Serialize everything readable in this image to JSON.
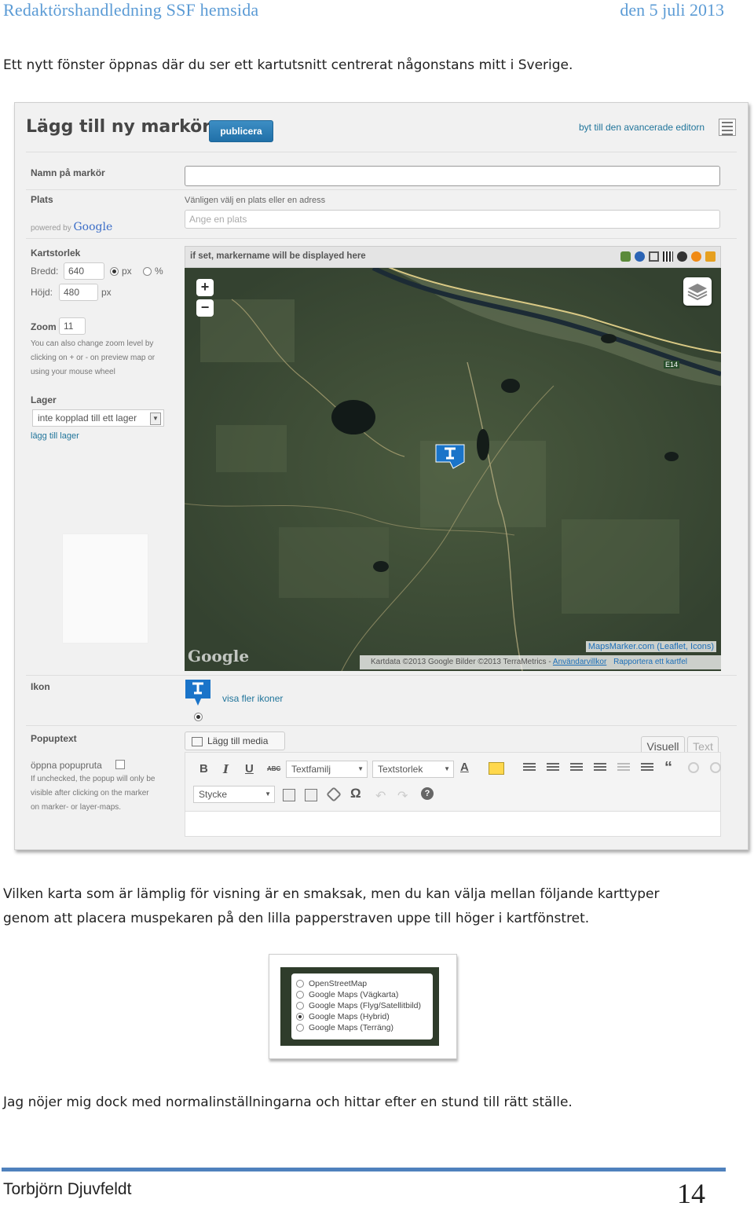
{
  "header": {
    "doc_title": "Redaktörshandledning SSF hemsida",
    "date": "den 5 juli 2013"
  },
  "intro": "Ett nytt fönster öppnas där du ser ett kartutsnitt centrerat någonstans mitt i Sverige.",
  "editor_screen": {
    "title": "Lägg till ny markör",
    "publish_label": "publicera",
    "switch_editor_label": "byt till den avancerade editorn",
    "name_label": "Namn på markör",
    "name_value": "",
    "place_label": "Plats",
    "powered_by": "powered by",
    "google_label": "Google",
    "place_hint": "Vänligen välj en plats eller en adress",
    "place_placeholder": "Ange en plats",
    "mapsize_label": "Kartstorlek",
    "width_label": "Bredd:",
    "width_value": "640",
    "unit_px": "px",
    "unit_pct": "%",
    "height_label": "Höjd:",
    "height_value": "480",
    "height_unit": "px",
    "zoom_label": "Zoom",
    "zoom_value": "11",
    "zoom_note_1": "You can also change zoom level by",
    "zoom_note_2": "clicking on + or - on preview map or",
    "zoom_note_3": "using your mouse wheel",
    "layer_label": "Lager",
    "layer_value": "inte kopplad till ett lager",
    "add_layer_link": "lägg till lager",
    "map_caption": "if set, markername will be displayed here",
    "zoom_in": "+",
    "zoom_out": "−",
    "road_label": "E14",
    "attribution_link": "MapsMarker.com (Leaflet, Icons)",
    "map_credits": "Kartdata ©2013 Google Bilder ©2013 TerraMetrics -",
    "terms_link": "Användarvillkor",
    "report_link": "Rapportera ett kartfel",
    "google_watermark": "Google",
    "icon_label": "Ikon",
    "more_icons_link": "visa fler ikoner",
    "popup_label": "Popuptext",
    "add_media_label": "Lägg till media",
    "tab_visual": "Visuell",
    "tab_text": "Text",
    "open_popup_label": "öppna popupruta",
    "popup_note_1": "If unchecked, the popup will only be",
    "popup_note_2": "visible after clicking on the marker",
    "popup_note_3": "on marker- or layer-maps.",
    "font_family_select": "Textfamilj",
    "font_size_select": "Textstorlek",
    "format_select": "Stycke",
    "tb_bold": "B",
    "tb_italic": "I",
    "tb_underline": "U",
    "tb_strike": "ABC",
    "tb_quote": "“",
    "tb_omega": "Ω",
    "tb_help": "?"
  },
  "middle_text_line1": "Vilken karta som är lämplig för visning är en smaksak, men du kan välja mellan följande karttyper",
  "middle_text_line2": "genom att placera muspekaren på den lilla papperstraven uppe till höger i kartfönstret.",
  "map_types": {
    "options": [
      "OpenStreetMap",
      "Google Maps (Vägkarta)",
      "Google Maps (Flyg/Satellitbild)",
      "Google Maps (Hybrid)",
      "Google Maps (Terräng)"
    ],
    "selected": "Google Maps (Hybrid)"
  },
  "closing_text": "Jag nöjer mig dock med normalinställningarna och hittar efter en stund till rätt ställe.",
  "footer": {
    "author": "Torbjörn Djuvfeldt",
    "page": "14"
  },
  "colors": {
    "header_blue": "#5b9bd5",
    "footer_rule": "#4f81bd",
    "link_blue": "#21759b",
    "publish_button": "#2a7ab5",
    "map_dark_green": "#3b4a34"
  }
}
